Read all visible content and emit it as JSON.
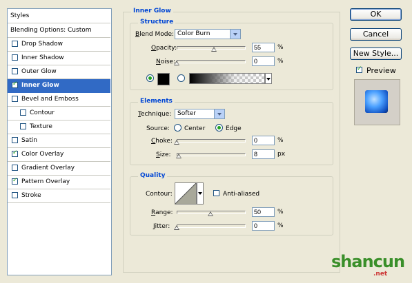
{
  "styles_panel": {
    "header": "Styles",
    "blending_options": "Blending Options: Custom",
    "items": [
      {
        "label": "Drop Shadow",
        "checked": false,
        "selected": false,
        "indent": false
      },
      {
        "label": "Inner Shadow",
        "checked": false,
        "selected": false,
        "indent": false
      },
      {
        "label": "Outer Glow",
        "checked": false,
        "selected": false,
        "indent": false
      },
      {
        "label": "Inner Glow",
        "checked": true,
        "selected": true,
        "indent": false
      },
      {
        "label": "Bevel and Emboss",
        "checked": false,
        "selected": false,
        "indent": false
      },
      {
        "label": "Contour",
        "checked": false,
        "selected": false,
        "indent": true
      },
      {
        "label": "Texture",
        "checked": false,
        "selected": false,
        "indent": true
      },
      {
        "label": "Satin",
        "checked": false,
        "selected": false,
        "indent": false
      },
      {
        "label": "Color Overlay",
        "checked": true,
        "selected": false,
        "indent": false
      },
      {
        "label": "Gradient Overlay",
        "checked": false,
        "selected": false,
        "indent": false
      },
      {
        "label": "Pattern Overlay",
        "checked": true,
        "selected": false,
        "indent": false
      },
      {
        "label": "Stroke",
        "checked": false,
        "selected": false,
        "indent": false
      }
    ]
  },
  "inner_glow": {
    "title": "Inner Glow",
    "structure": {
      "title": "Structure",
      "blend_mode_label": "Blend Mode:",
      "blend_mode_value": "Color Burn",
      "opacity_label": "Opacity:",
      "opacity_value": "55",
      "opacity_unit": "%",
      "opacity_fraction": 0.55,
      "noise_label": "Noise:",
      "noise_value": "0",
      "noise_unit": "%",
      "noise_fraction": 0.0,
      "color_mode": "solid"
    },
    "elements": {
      "title": "Elements",
      "technique_label": "Technique:",
      "technique_value": "Softer",
      "source_label": "Source:",
      "source_center": "Center",
      "source_edge": "Edge",
      "source_selected": "edge",
      "choke_label": "Choke:",
      "choke_value": "0",
      "choke_unit": "%",
      "choke_fraction": 0.0,
      "size_label": "Size:",
      "size_value": "8",
      "size_unit": "px",
      "size_fraction": 0.033
    },
    "quality": {
      "title": "Quality",
      "contour_label": "Contour:",
      "anti_aliased_label": "Anti-aliased",
      "anti_aliased": false,
      "range_label": "Range:",
      "range_value": "50",
      "range_unit": "%",
      "range_fraction": 0.5,
      "jitter_label": "Jitter:",
      "jitter_value": "0",
      "jitter_unit": "%",
      "jitter_fraction": 0.0
    }
  },
  "buttons": {
    "ok": "OK",
    "cancel": "Cancel",
    "new_style": "New Style...",
    "preview_label": "Preview",
    "preview_checked": true
  },
  "watermark": {
    "text": "shancun",
    "sub": ".net"
  },
  "colors": {
    "selection": "#316ac5",
    "group_title": "#0046d5",
    "glow_color": "#000000",
    "background": "#ece9d8"
  }
}
